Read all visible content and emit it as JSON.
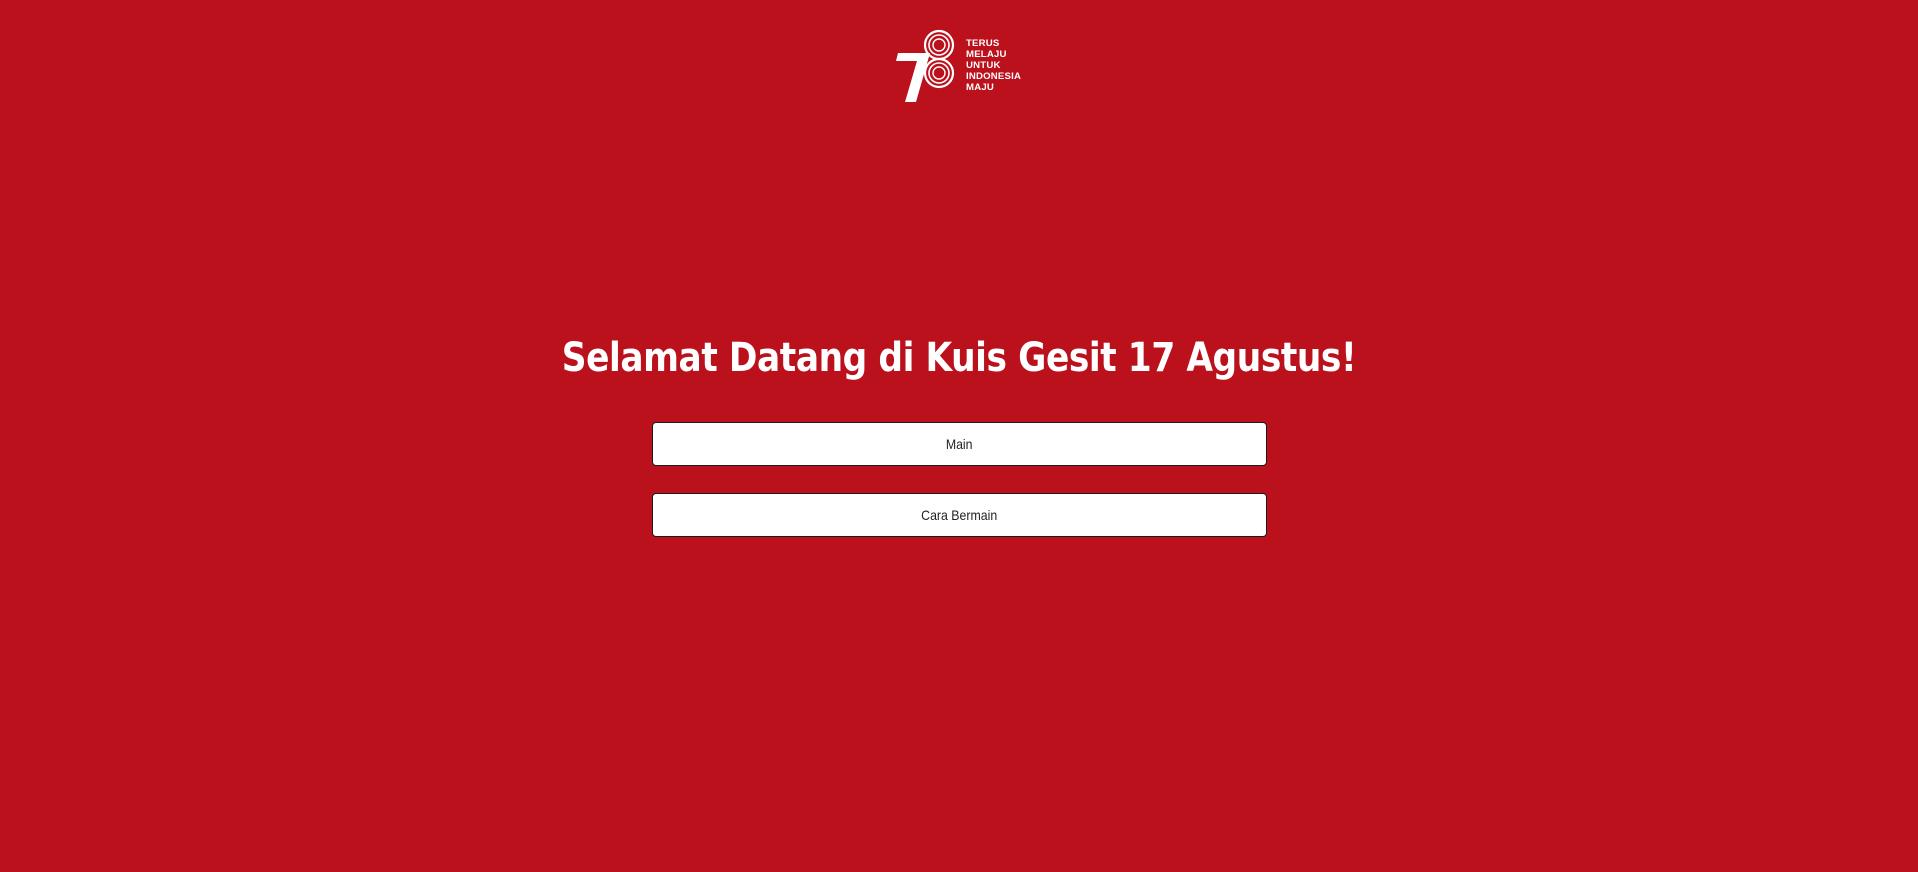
{
  "logo": {
    "number": "78",
    "lines": [
      "TERUS",
      "MELAJU",
      "UNTUK",
      "INDONESIA",
      "MAJU"
    ]
  },
  "welcome": {
    "title": "Selamat Datang di Kuis Gesit 17 Agustus!"
  },
  "menu": {
    "play_label": "Main",
    "how_to_play_label": "Cara Bermain"
  },
  "theme": {
    "background": "#bb111c",
    "button_bg": "#ffffff",
    "text": "#ffffff"
  }
}
